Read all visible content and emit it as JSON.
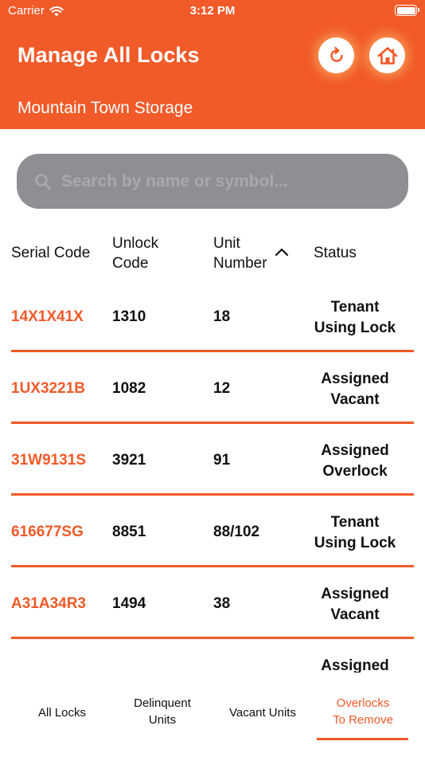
{
  "status_bar": {
    "carrier": "Carrier",
    "time": "3:12 PM"
  },
  "header": {
    "title": "Manage All Locks",
    "subtitle": "Mountain Town Storage",
    "icons": [
      "refresh-icon",
      "home-icon"
    ]
  },
  "search": {
    "placeholder": "Search by name or symbol...",
    "value": ""
  },
  "table": {
    "columns": {
      "serial": "Serial Code",
      "unlock_line1": "Unlock",
      "unlock_line2": "Code",
      "unit_line1": "Unit",
      "unit_line2": "Number",
      "status": "Status"
    },
    "sort_icon": "chevron-up-icon",
    "rows": [
      {
        "serial": "14X1X41X",
        "code": "1310",
        "unit": "18",
        "status_line1": "Tenant",
        "status_line2": "Using Lock"
      },
      {
        "serial": "1UX3221B",
        "code": "1082",
        "unit": "12",
        "status_line1": "Assigned",
        "status_line2": "Vacant"
      },
      {
        "serial": "31W9131S",
        "code": "3921",
        "unit": "91",
        "status_line1": "Assigned",
        "status_line2": "Overlock"
      },
      {
        "serial": "616677SG",
        "code": "8851",
        "unit": "88/102",
        "status_line1": "Tenant",
        "status_line2": "Using Lock"
      },
      {
        "serial": "A31A34R3",
        "code": "1494",
        "unit": "38",
        "status_line1": "Assigned",
        "status_line2": "Vacant"
      },
      {
        "serial": "",
        "code": "",
        "unit": "",
        "status_line1": "Assigned",
        "status_line2": ""
      }
    ]
  },
  "tabs": {
    "all_locks": "All Locks",
    "delinquent_line1": "Delinquent",
    "delinquent_line2": "Units",
    "vacant_units": "Vacant Units",
    "overlocks_line1": "Overlocks",
    "overlocks_line2": "To Remove",
    "active": "overlocks"
  },
  "colors": {
    "brand": "#f15a29",
    "search_bg": "#8e8e93",
    "white": "#ffffff"
  }
}
